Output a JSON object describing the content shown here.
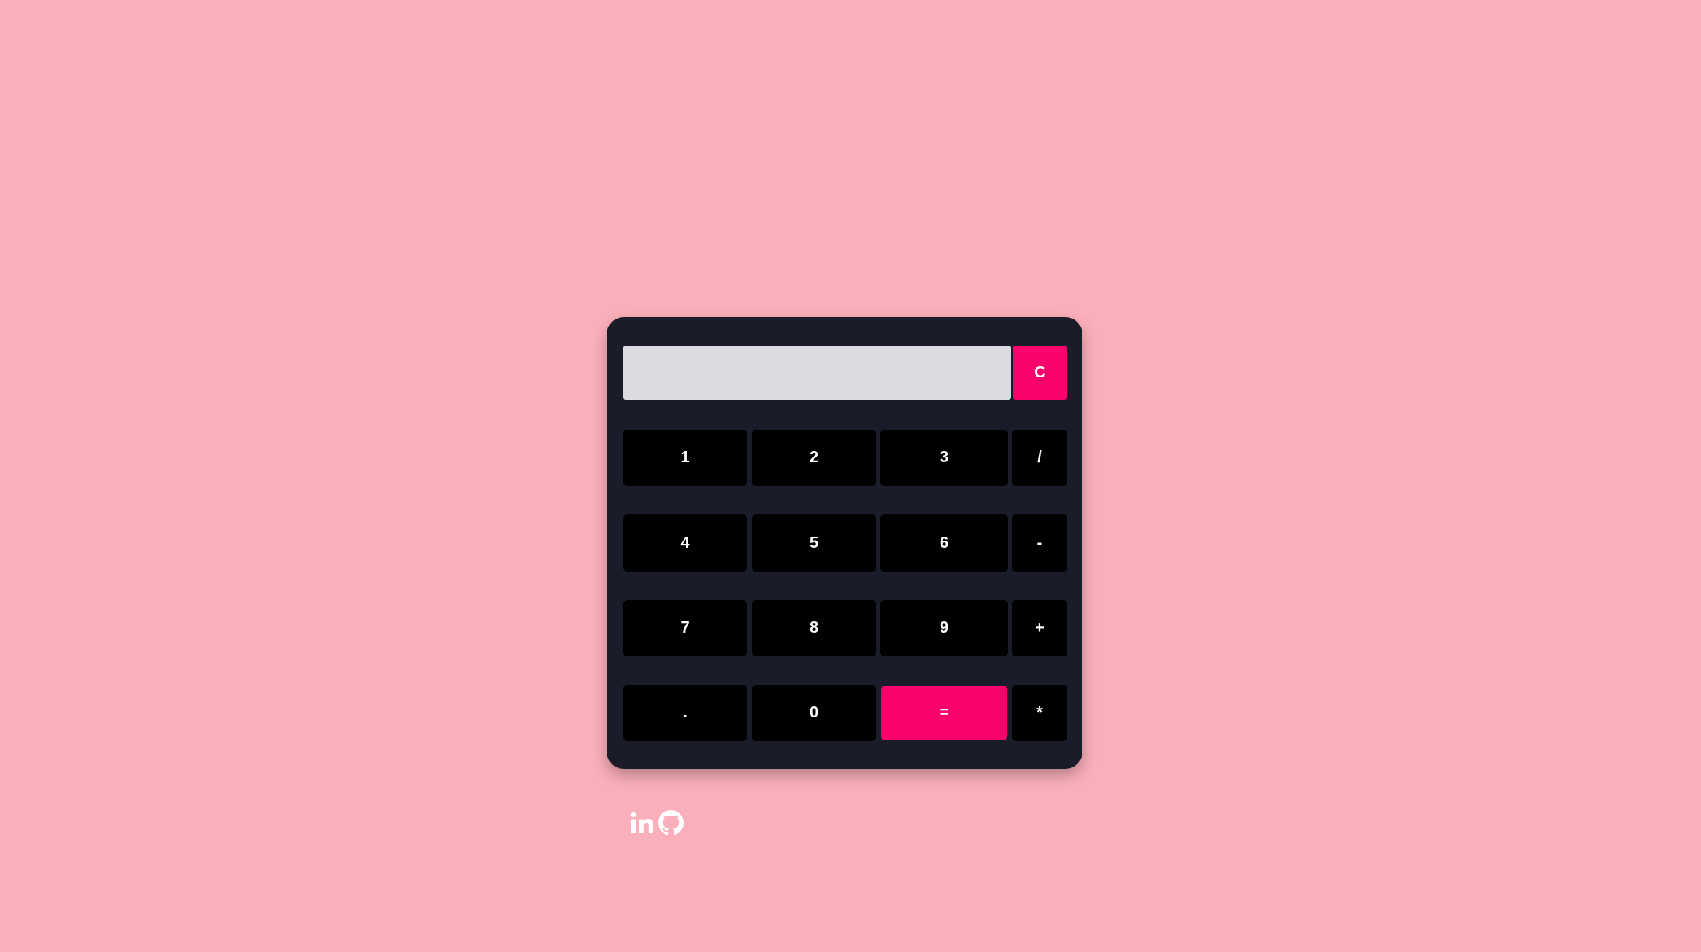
{
  "display": {
    "value": "",
    "placeholder": ""
  },
  "buttons": {
    "clear": "C",
    "one": "1",
    "two": "2",
    "three": "3",
    "divide": "/",
    "four": "4",
    "five": "5",
    "six": "6",
    "subtract": "-",
    "seven": "7",
    "eight": "8",
    "nine": "9",
    "add": "+",
    "decimal": ".",
    "zero": "0",
    "equals": "=",
    "multiply": "*"
  },
  "social": {
    "icons": [
      "linkedin-icon",
      "github-icon"
    ]
  },
  "colors": {
    "background": "#fbafba",
    "calculator_body": "#1b1c29",
    "display_bg": "#dcdbe1",
    "key_bg": "#000000",
    "accent": "#f8026b",
    "text": "#ffffff"
  }
}
